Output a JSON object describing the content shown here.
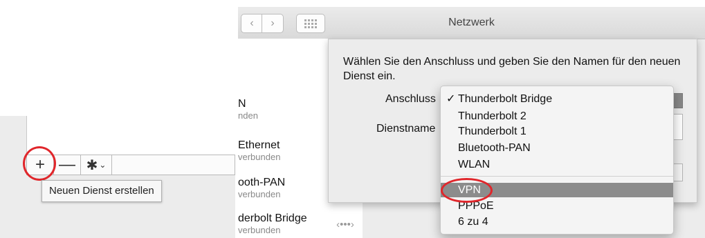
{
  "window": {
    "title": "Netzwerk"
  },
  "services": [
    {
      "name": "N",
      "status": "nden"
    },
    {
      "name": "Ethernet",
      "status": "verbunden"
    },
    {
      "name": "ooth-PAN",
      "status": "verbunden"
    },
    {
      "name": "derbolt Bridge",
      "status": "verbunden"
    }
  ],
  "toolbar": {
    "add_label": "+",
    "remove_label": "—",
    "gear_label": "✱",
    "chevron_label": "⌄"
  },
  "tooltip": "Neuen Dienst erstellen",
  "sheet": {
    "message": "Wählen Sie den Anschluss und geben Sie den Namen für den neuen Dienst ein.",
    "anschluss_label": "Anschluss",
    "dienstname_label": "Dienstname"
  },
  "menu": {
    "check": "✓",
    "items": [
      "Thunderbolt Bridge",
      "Thunderbolt 2",
      "Thunderbolt 1",
      "Bluetooth-PAN",
      "WLAN",
      "VPN",
      "PPPoE",
      "6 zu 4"
    ],
    "selected": "VPN",
    "checked": "Thunderbolt Bridge"
  },
  "colors": {
    "highlight_circle": "#e0262b",
    "menu_selection": "#8c8c8c"
  },
  "icons": {
    "back": "chevron-left-icon",
    "forward": "chevron-right-icon",
    "grid": "grid-icon",
    "gear": "gear-icon",
    "arrows": "horizontal-resize-icon"
  }
}
